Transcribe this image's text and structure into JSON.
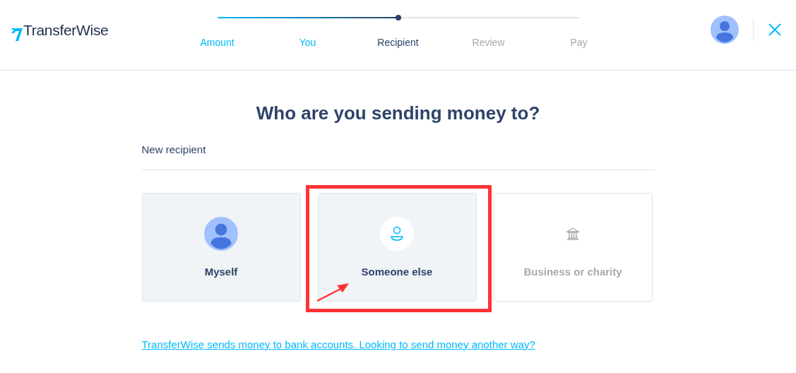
{
  "logo": {
    "text": "TransferWise"
  },
  "progress": {
    "level": 0.5,
    "steps": [
      {
        "label": "Amount",
        "completed": true,
        "selected": false
      },
      {
        "label": "You",
        "completed": true,
        "selected": false
      },
      {
        "label": "Recipient",
        "completed": false,
        "selected": true
      },
      {
        "label": "Review",
        "completed": false,
        "selected": false
      },
      {
        "label": "Pay",
        "completed": false,
        "selected": false
      }
    ]
  },
  "title": "Who are you sending money to?",
  "section_label": "New recipient",
  "options": [
    {
      "label": "Myself",
      "kind": "avatar",
      "disabled": false,
      "annotated": false
    },
    {
      "label": "Someone else",
      "kind": "person",
      "disabled": false,
      "annotated": true
    },
    {
      "label": "Business or charity",
      "kind": "bank",
      "disabled": true,
      "annotated": false
    }
  ],
  "footer_link": "TransferWise sends money to bank accounts. Looking to send money another way?"
}
